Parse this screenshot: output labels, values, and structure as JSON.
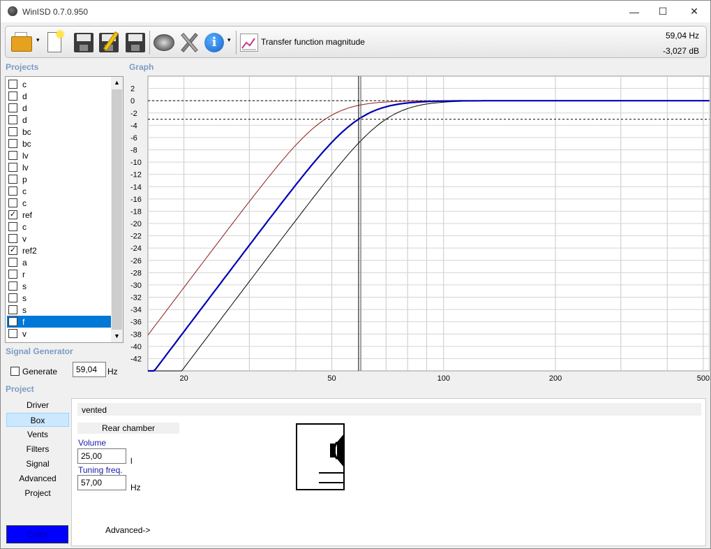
{
  "window": {
    "title": "WinISD 0.7.0.950",
    "minimize": "—",
    "maximize": "☐",
    "close": "✕"
  },
  "toolbar": {
    "graph_type": "Transfer function magnitude",
    "cursor_freq": "59,04 Hz",
    "cursor_level": "-3,027 dB",
    "dropdown_arrow": "▾"
  },
  "sections": {
    "projects": "Projects",
    "graph": "Graph",
    "signal_generator": "Signal Generator",
    "project": "Project"
  },
  "projects": [
    {
      "name": "c",
      "checked": false
    },
    {
      "name": "d",
      "checked": false
    },
    {
      "name": "d",
      "checked": false
    },
    {
      "name": "d",
      "checked": false
    },
    {
      "name": "bc",
      "checked": false
    },
    {
      "name": "bc",
      "checked": false
    },
    {
      "name": "lv",
      "checked": false
    },
    {
      "name": "lv",
      "checked": false
    },
    {
      "name": "p",
      "checked": false
    },
    {
      "name": "c",
      "checked": false
    },
    {
      "name": "c",
      "checked": false
    },
    {
      "name": "ref",
      "checked": true
    },
    {
      "name": "c",
      "checked": false
    },
    {
      "name": "v",
      "checked": false
    },
    {
      "name": "ref2",
      "checked": true
    },
    {
      "name": "a",
      "checked": false
    },
    {
      "name": "r",
      "checked": false
    },
    {
      "name": "s",
      "checked": false
    },
    {
      "name": "s",
      "checked": false
    },
    {
      "name": "s",
      "checked": false
    },
    {
      "name": "f",
      "checked": true,
      "selected": true
    },
    {
      "name": "v",
      "checked": false
    }
  ],
  "signal_generator": {
    "generate_label": "Generate",
    "frequency": "59,04",
    "unit": "Hz",
    "checked": false
  },
  "graph": {
    "y_ticks": [
      "2",
      "0",
      "-2",
      "-4",
      "-6",
      "-8",
      "-10",
      "-12",
      "-14",
      "-16",
      "-18",
      "-20",
      "-22",
      "-24",
      "-26",
      "-28",
      "-30",
      "-32",
      "-34",
      "-36",
      "-38",
      "-40",
      "-42"
    ],
    "x_ticks": [
      "20",
      "50",
      "100",
      "200",
      "500"
    ],
    "series_colors": {
      "ref": "#8b1a1a",
      "ref2": "#000000",
      "f": "#0000b4"
    }
  },
  "nav": [
    "Driver",
    "Box",
    "Vents",
    "Filters",
    "Signal",
    "Advanced",
    "Project"
  ],
  "nav_active": "Box",
  "color_button": "Color",
  "box": {
    "type": "vented",
    "chamber": "Rear chamber",
    "volume_label": "Volume",
    "volume_value": "25,00",
    "volume_unit": "l",
    "tuning_label": "Tuning freq.",
    "tuning_value": "57,00",
    "tuning_unit": "Hz",
    "advanced": "Advanced->"
  }
}
